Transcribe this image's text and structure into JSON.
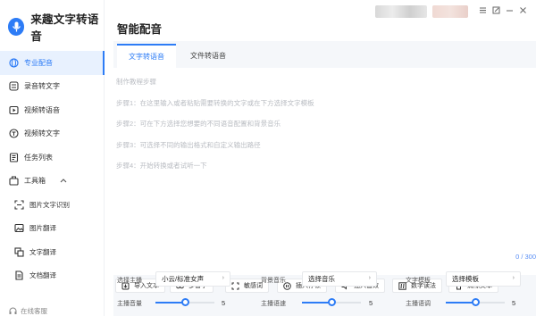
{
  "app": {
    "name": "来趣文字转语音",
    "footer": "在线客服"
  },
  "sidebar": {
    "items": [
      {
        "label": "专业配音",
        "icon": "globe-icon",
        "active": true
      },
      {
        "label": "录音转文字",
        "icon": "record-icon"
      },
      {
        "label": "视频转语音",
        "icon": "video-icon"
      },
      {
        "label": "视频转文字",
        "icon": "video-text-icon"
      },
      {
        "label": "任务列表",
        "icon": "task-list-icon"
      },
      {
        "label": "工具箱",
        "icon": "toolbox-icon",
        "expanded": true
      },
      {
        "label": "图片文字识别",
        "icon": "ocr-icon"
      },
      {
        "label": "图片翻译",
        "icon": "image-translate-icon"
      },
      {
        "label": "文字翻译",
        "icon": "text-translate-icon"
      },
      {
        "label": "文档翻译",
        "icon": "doc-translate-icon"
      }
    ]
  },
  "header": {
    "title": "智能配音"
  },
  "tabs": [
    {
      "label": "文字转语音",
      "active": true
    },
    {
      "label": "文件转语音",
      "active": false
    }
  ],
  "editor": {
    "steps": [
      "制作教程步骤",
      "步骤1：在这里输入或者粘贴需要转换的文字或在下方选择文字模板",
      "步骤2：可在下方选择您想要的不同语音配置和背景音乐",
      "步骤3：可选择不同的输出格式和自定义输出路径",
      "步骤4：开始转换或者试听一下"
    ],
    "counter": "0 / 300"
  },
  "toolbar": [
    {
      "label": "导入文本",
      "icon": "import-icon"
    },
    {
      "label": "多音字",
      "icon": "polyphone-icon"
    },
    {
      "label": "敏感词",
      "icon": "sensitive-word-icon"
    },
    {
      "label": "插入停顿",
      "icon": "pause-icon"
    },
    {
      "label": "插入音效",
      "icon": "sound-effect-icon"
    },
    {
      "label": "数字读法",
      "icon": "number-icon"
    },
    {
      "label": "清除文本",
      "icon": "trash-icon"
    }
  ],
  "settings": {
    "anchor_label": "选择主播",
    "anchor_value": "小云/标准女声",
    "bgm_label": "背景音乐",
    "bgm_value": "选择音乐",
    "template_label": "文字模板",
    "template_value": "选择模板",
    "volume_label": "主播音量",
    "volume_value": "5",
    "speed_label": "主播语速",
    "speed_value": "5",
    "pitch_label": "主播语调",
    "pitch_value": "5",
    "slider_fraction": 0.5
  },
  "colors": {
    "accent": "#2d7cf6",
    "active_bg": "#e8f1fe",
    "content_bg": "#f5f7fa"
  }
}
